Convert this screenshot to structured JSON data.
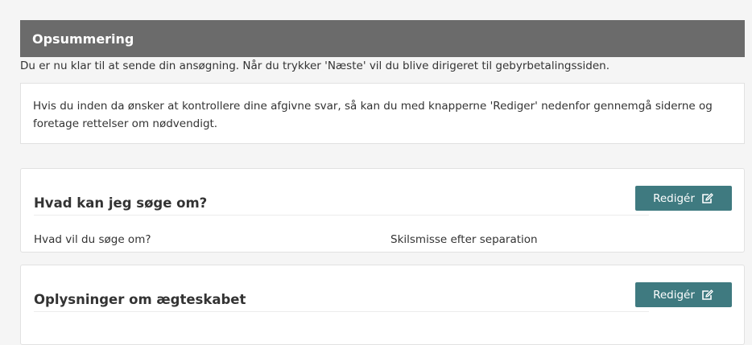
{
  "header": {
    "title": "Opsummering"
  },
  "intro_text": "Du er nu klar til at sende din ansøgning. Når du trykker 'Næste' vil du blive dirigeret til gebyrbetalingssiden.",
  "notice_text": "Hvis du inden da ønsker at kontrollere dine afgivne svar, så kan du med knapperne 'Rediger' nedenfor gennemgå siderne og foretage rettelser om nødvendigt.",
  "sections": [
    {
      "title": "Hvad kan jeg søge om?",
      "edit_label": "Redigér",
      "edit_icon": "edit-icon",
      "fields": [
        {
          "label": "Hvad vil du søge om?",
          "value": "Skilsmisse efter separation"
        }
      ]
    },
    {
      "title": "Oplysninger om ægteskabet",
      "edit_label": "Redigér",
      "edit_icon": "edit-icon"
    }
  ],
  "colors": {
    "header_bg": "#6b6b6b",
    "button_bg": "#3f7a80",
    "page_bg": "#f5f5f5"
  }
}
